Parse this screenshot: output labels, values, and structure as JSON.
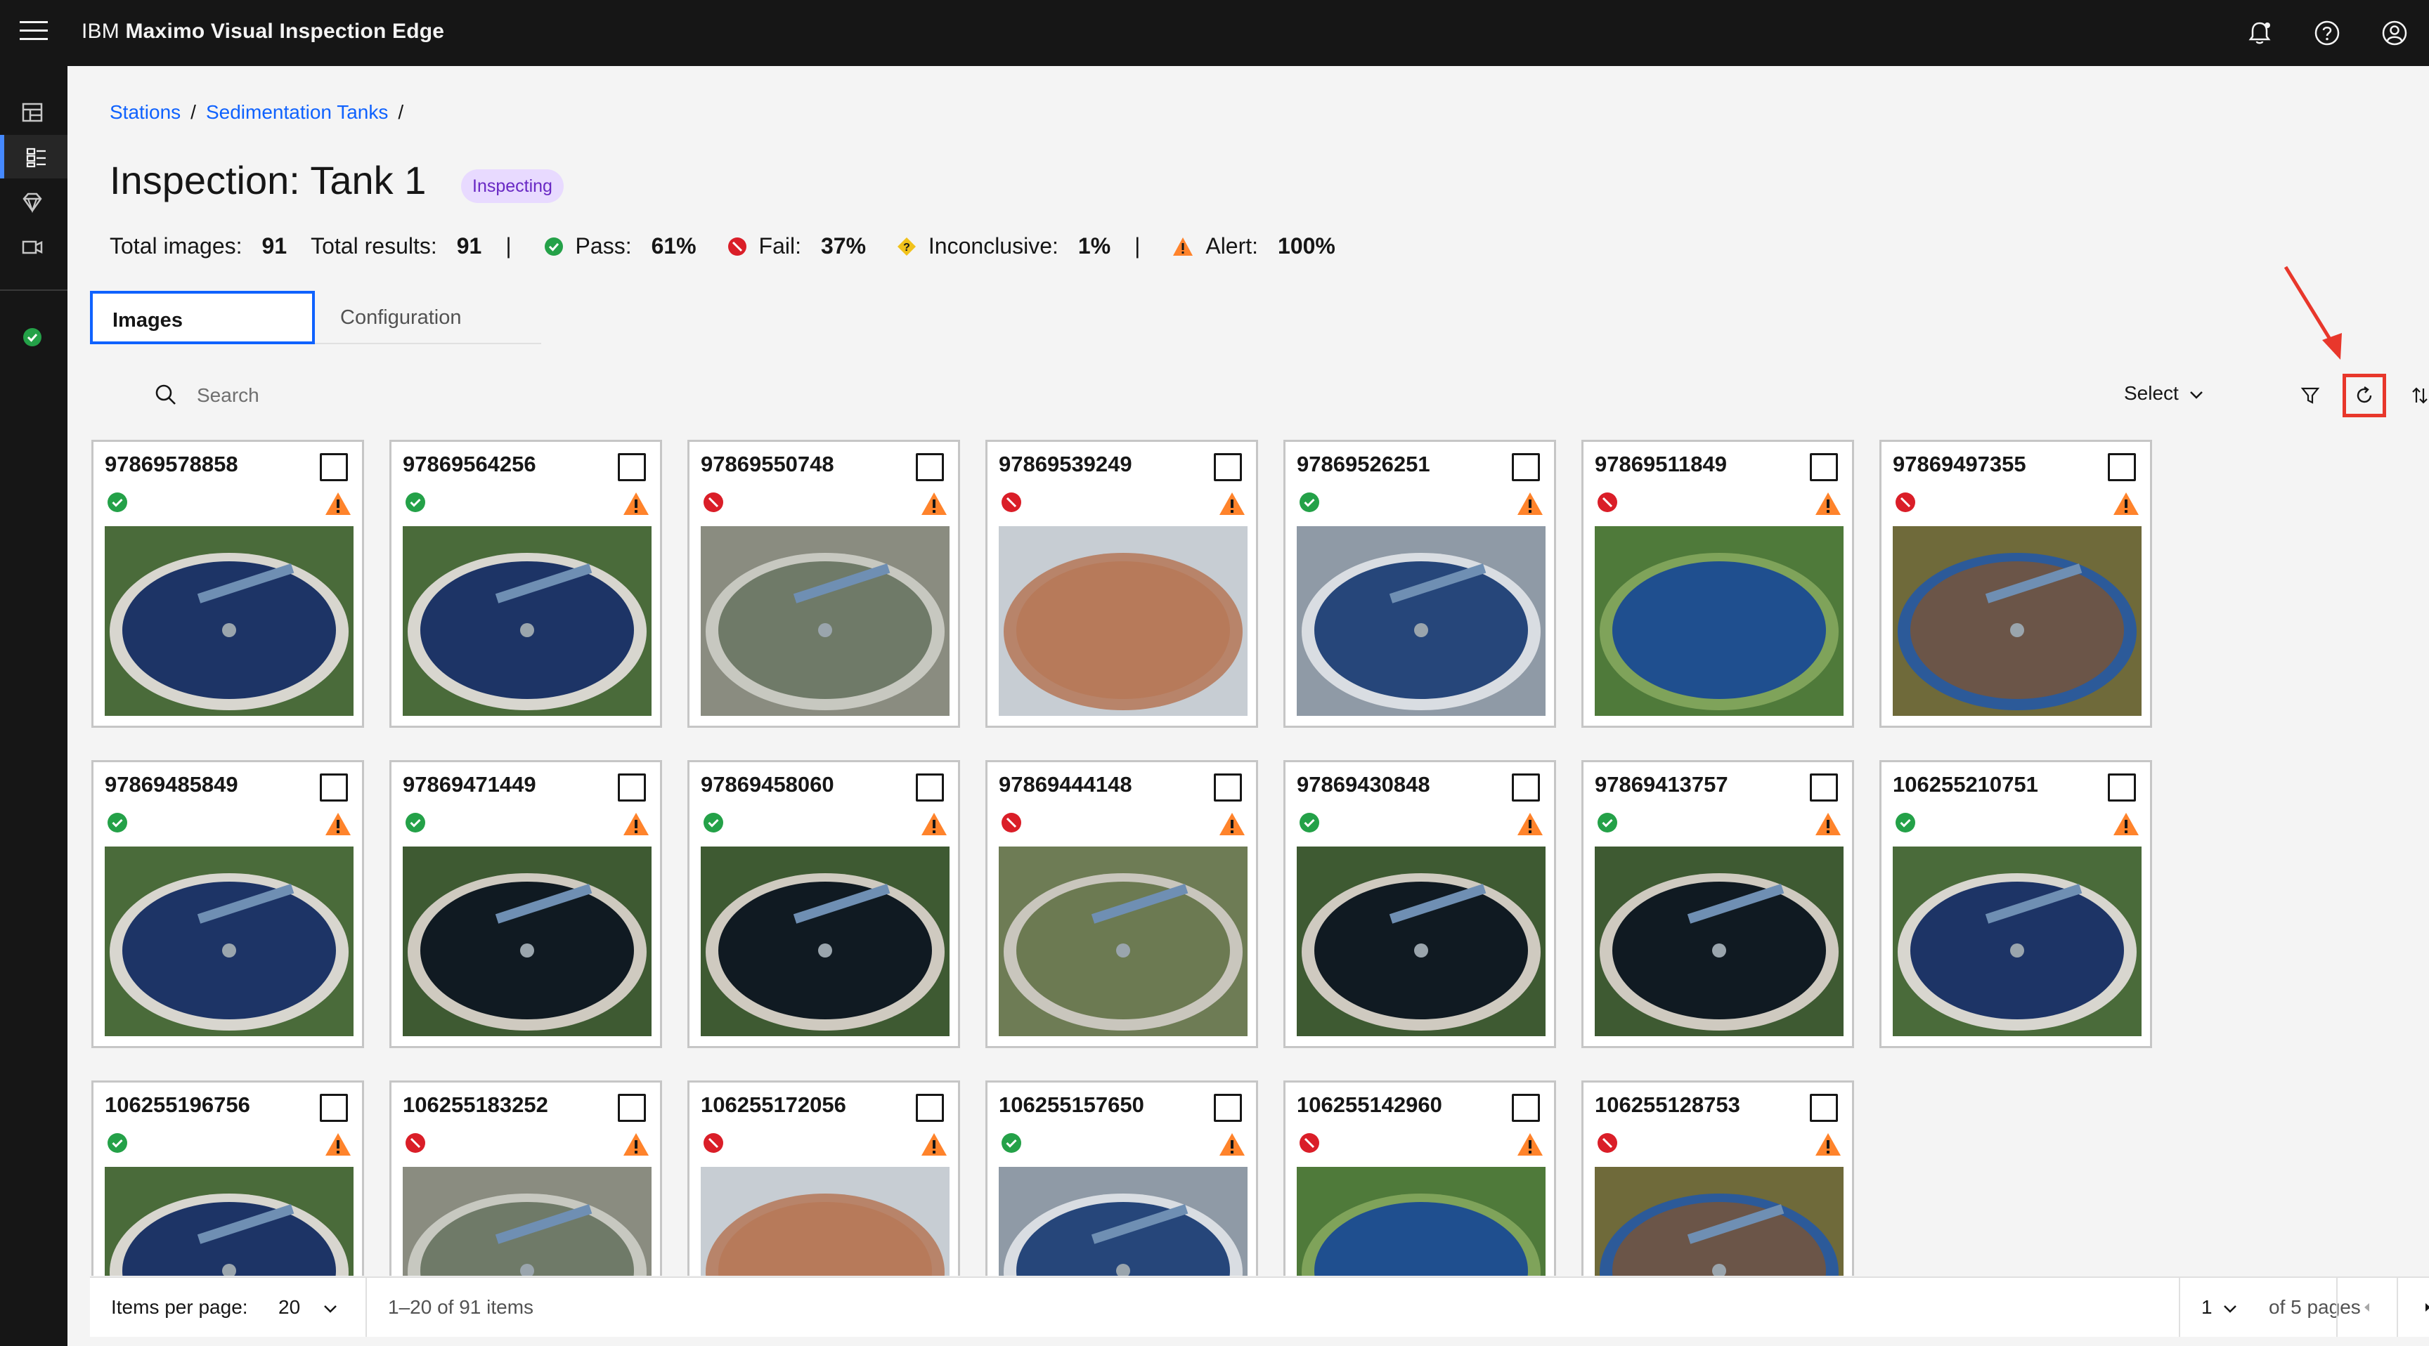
{
  "app": {
    "title_prefix": "IBM",
    "title_name": "Maximo Visual Inspection Edge"
  },
  "header_icons": [
    "notification-icon",
    "help-icon",
    "user-avatar-icon"
  ],
  "sidebar": {
    "items": [
      "dashboard-icon",
      "stations-icon",
      "models-icon",
      "camera-icon"
    ],
    "active_index": 1,
    "status_icon": "connected-status-icon"
  },
  "breadcrumb": {
    "items": [
      "Stations",
      "Sedimentation Tanks"
    ],
    "separator": "/"
  },
  "page": {
    "title": "Inspection: Tank 1",
    "status": "Inspecting"
  },
  "summary": {
    "total_images_label": "Total images:",
    "total_images": "91",
    "total_results_label": "Total results:",
    "total_results": "91",
    "divider": "|",
    "pass_label": "Pass:",
    "pass": "61%",
    "fail_label": "Fail:",
    "fail": "37%",
    "inconclusive_label": "Inconclusive:",
    "inconclusive": "1%",
    "alert_label": "Alert:",
    "alert": "100%"
  },
  "tabs": [
    {
      "label": "Images",
      "active": true
    },
    {
      "label": "Configuration",
      "active": false
    }
  ],
  "toolbar": {
    "search_placeholder": "Search",
    "select_label": "Select",
    "icons": [
      "filter-icon",
      "refresh-icon",
      "sort-icon"
    ]
  },
  "colors": {
    "pass": "#24a148",
    "fail": "#da1e28",
    "inconclusive": "#f1c21b",
    "alert": "#ff832b",
    "accent": "#0f62fe",
    "annotation": "#e8372b"
  },
  "cards": [
    {
      "id": "97869578858",
      "result": "pass",
      "alert": true,
      "scene": "tank-arm"
    },
    {
      "id": "97869564256",
      "result": "pass",
      "alert": true,
      "scene": "tank-arm"
    },
    {
      "id": "97869550748",
      "result": "fail",
      "alert": true,
      "scene": "tank-greenish"
    },
    {
      "id": "97869539249",
      "result": "fail",
      "alert": true,
      "scene": "tank-empty"
    },
    {
      "id": "97869526251",
      "result": "pass",
      "alert": true,
      "scene": "tank-plant"
    },
    {
      "id": "97869511849",
      "result": "fail",
      "alert": true,
      "scene": "tank-blurry"
    },
    {
      "id": "97869497355",
      "result": "fail",
      "alert": true,
      "scene": "tank-brown"
    },
    {
      "id": "97869485849",
      "result": "pass",
      "alert": true,
      "scene": "tank-arm"
    },
    {
      "id": "97869471449",
      "result": "pass",
      "alert": true,
      "scene": "tank-dark"
    },
    {
      "id": "97869458060",
      "result": "pass",
      "alert": true,
      "scene": "tank-dark"
    },
    {
      "id": "97869444148",
      "result": "fail",
      "alert": true,
      "scene": "tank-overgrown"
    },
    {
      "id": "97869430848",
      "result": "pass",
      "alert": true,
      "scene": "tank-dark"
    },
    {
      "id": "97869413757",
      "result": "pass",
      "alert": true,
      "scene": "tank-dark"
    },
    {
      "id": "106255210751",
      "result": "pass",
      "alert": true,
      "scene": "tank-arm"
    },
    {
      "id": "106255196756",
      "result": "pass",
      "alert": true,
      "scene": "tank-arm"
    },
    {
      "id": "106255183252",
      "result": "fail",
      "alert": true,
      "scene": "tank-greenish"
    },
    {
      "id": "106255172056",
      "result": "fail",
      "alert": true,
      "scene": "tank-empty"
    },
    {
      "id": "106255157650",
      "result": "pass",
      "alert": true,
      "scene": "tank-plant"
    },
    {
      "id": "106255142960",
      "result": "fail",
      "alert": true,
      "scene": "tank-blurry"
    },
    {
      "id": "106255128753",
      "result": "fail",
      "alert": true,
      "scene": "tank-brown"
    }
  ],
  "pagination": {
    "items_per_page_label": "Items per page:",
    "items_per_page": "20",
    "range_text": "1–20 of 91 items",
    "current_page": "1",
    "pages_text": "of 5 pages"
  }
}
